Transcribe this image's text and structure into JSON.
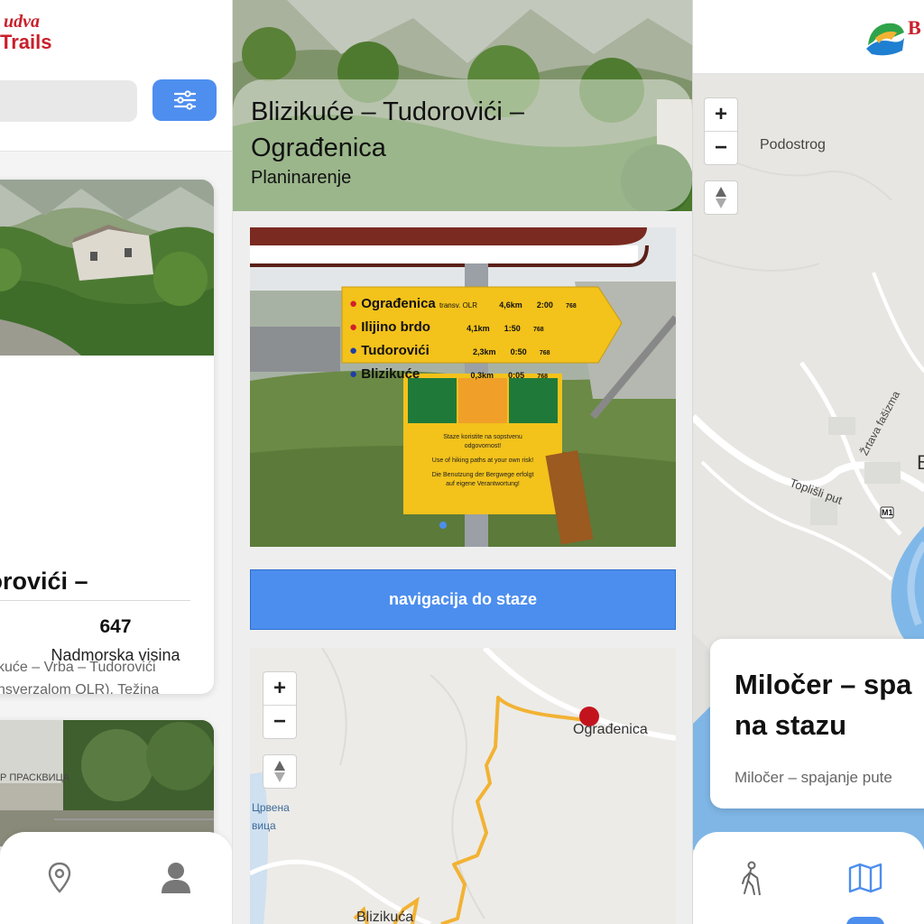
{
  "left_screen": {
    "logo": {
      "line1": "udva",
      "line2": "Trails"
    },
    "trail_card": {
      "title": "dorovići –",
      "description": "kuće – Vrba – Tudorovići\nnsverzalom OLR), Težina\ndorovića i laka Staza\nsegment do Tudorovića i\nng",
      "stat_value": "647",
      "stat_label": "Nadmorska visina"
    },
    "second_card_sign": "Р ПРАСКВИЦА"
  },
  "middle_screen": {
    "hero": {
      "title": "Blizikuće – Tudorovići – Ograđenica",
      "subtitle": "Planinarenje"
    },
    "signpost": {
      "rows": [
        {
          "name": "Ograđenica",
          "note": "transv. OLR",
          "dist": "4,6km",
          "time": "2:00",
          "code": "768",
          "dot": "#d11f2b"
        },
        {
          "name": "Ilijino brdo",
          "note": "",
          "dist": "4,1km",
          "time": "1:50",
          "code": "768",
          "dot": "#d11f2b"
        },
        {
          "name": "Tudorovići",
          "note": "",
          "dist": "2,3km",
          "time": "0:50",
          "code": "768",
          "dot": "#1f3ea8"
        },
        {
          "name": "Blizikuće",
          "note": "",
          "dist": "0,3km",
          "time": "0:05",
          "code": "768",
          "dot": "#1f3ea8"
        }
      ],
      "warning_lines": [
        "Staze koristite na sopstvenu",
        "odgovornost!",
        "Use of hiking paths at your own risk!",
        "Die Benutzung der Bergwege erfolgt",
        "auf eigene Verantwortung!"
      ]
    },
    "navigate_button": "navigacija do staze",
    "map": {
      "zoom_in": "+",
      "zoom_out": "−",
      "label_end": "Ograđenica",
      "label_start": "Blizikuća",
      "label_red": "Црвена",
      "label_red2": "вица"
    }
  },
  "right_screen": {
    "logo_text": "B",
    "map": {
      "zoom_in": "+",
      "zoom_out": "−",
      "labels": {
        "podostrog": "Podostrog",
        "toplisk": "Toplišli put",
        "zrtava": "Žrtava fašizma",
        "road": "M1",
        "edge": "B"
      }
    },
    "info_card": {
      "title": "Miločer – spa na stazu",
      "subtitle": "Miločer – spajanje pute"
    }
  },
  "colors": {
    "accent_blue": "#4c8eee",
    "brand_red": "#c8202b",
    "trail_orange": "#f2b233",
    "marker_red": "#c3141e"
  }
}
